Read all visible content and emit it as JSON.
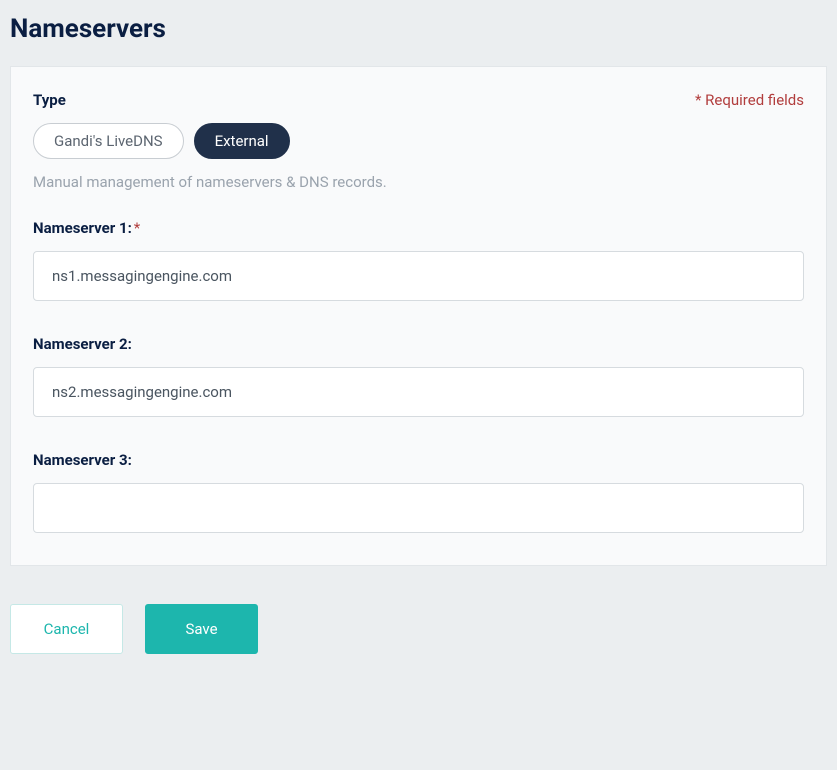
{
  "page": {
    "title": "Nameservers"
  },
  "panel": {
    "required_note": "* Required fields",
    "type": {
      "label": "Type",
      "options": {
        "livedns": "Gandi's LiveDNS",
        "external": "External"
      },
      "hint": "Manual management of nameservers & DNS records."
    },
    "ns1": {
      "label": "Nameserver 1:",
      "value": "ns1.messagingengine.com"
    },
    "ns2": {
      "label": "Nameserver 2:",
      "value": "ns2.messagingengine.com"
    },
    "ns3": {
      "label": "Nameserver 3:",
      "value": ""
    }
  },
  "actions": {
    "cancel": "Cancel",
    "save": "Save"
  }
}
